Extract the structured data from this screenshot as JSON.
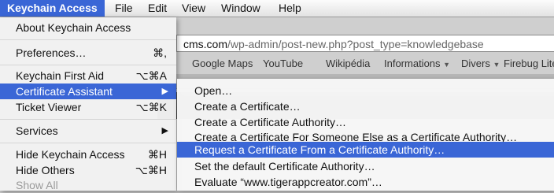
{
  "menubar": {
    "app": "Keychain Access",
    "items": [
      "File",
      "Edit",
      "View",
      "Window",
      "Help"
    ]
  },
  "browser": {
    "url_domain": "cms.com",
    "url_path": "/wp-admin/post-new.php?post_type=knowledgebase",
    "bookmarks": [
      "Google Maps",
      "YouTube",
      "Wikipédia",
      "Informations",
      "Divers",
      "Firebug Lite"
    ]
  },
  "menu": {
    "about": "About Keychain Access",
    "preferences": "Preferences…",
    "preferences_sc": "⌘,",
    "first_aid": "Keychain First Aid",
    "first_aid_sc": "⌥⌘A",
    "cert_assistant": "Certificate Assistant",
    "ticket_viewer": "Ticket Viewer",
    "ticket_viewer_sc": "⌥⌘K",
    "services": "Services",
    "hide": "Hide Keychain Access",
    "hide_sc": "⌘H",
    "hide_others": "Hide Others",
    "hide_others_sc": "⌥⌘H",
    "show_all": "Show All"
  },
  "submenu": {
    "items": [
      "Open…",
      "Create a Certificate…",
      "Create a Certificate Authority…",
      "Create a Certificate For Someone Else as a Certificate Authority…",
      "Request a Certificate From a Certificate Authority…",
      "Set the default Certificate Authority…",
      "Evaluate “www.tigerappcreator.com”…"
    ]
  }
}
